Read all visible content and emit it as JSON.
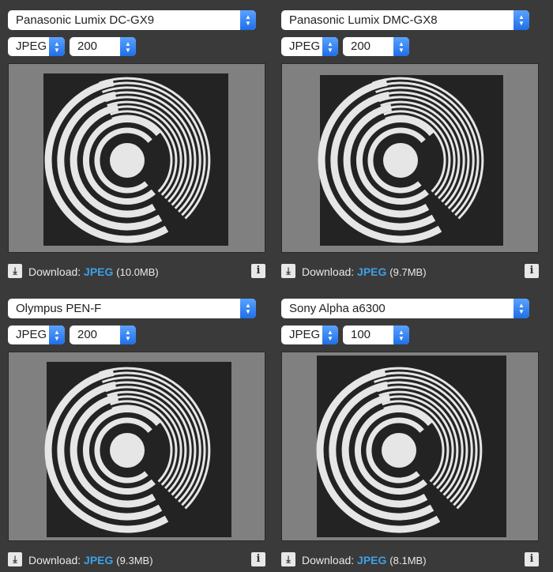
{
  "panels": [
    {
      "camera": "Panasonic Lumix DC-GX9",
      "format": "JPEG",
      "iso": "200",
      "download_label": "Download:",
      "download_link": "JPEG",
      "file_size": "(10.0MB)"
    },
    {
      "camera": "Panasonic Lumix DMC-GX8",
      "format": "JPEG",
      "iso": "200",
      "download_label": "Download:",
      "download_link": "JPEG",
      "file_size": "(9.7MB)"
    },
    {
      "camera": "Olympus PEN-F",
      "format": "JPEG",
      "iso": "200",
      "download_label": "Download:",
      "download_link": "JPEG",
      "file_size": "(9.3MB)"
    },
    {
      "camera": "Sony Alpha a6300",
      "format": "JPEG",
      "iso": "100",
      "download_label": "Download:",
      "download_link": "JPEG",
      "file_size": "(8.1MB)"
    }
  ],
  "icons": {
    "download": "download-icon",
    "info": "info-icon",
    "stepper": "up-down-chevron-icon"
  },
  "colors": {
    "page_bg": "#3a3a3a",
    "link": "#3ea0e6",
    "stepper": "#1f6fe8",
    "image_bg": "#808080",
    "card_bg": "#232323",
    "rings": "#e6e6e6"
  }
}
